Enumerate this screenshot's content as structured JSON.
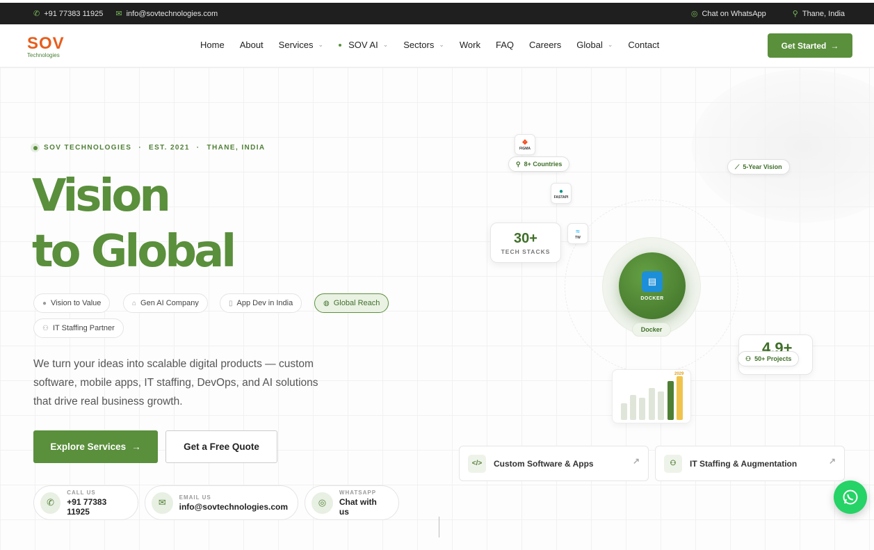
{
  "topbar": {
    "phone": "+91 77383 11925",
    "email": "info@sovtechnologies.com",
    "whatsapp": "Chat on WhatsApp",
    "location": "Thane, India"
  },
  "brand": {
    "logo_main": "SOV",
    "logo_sub": "Technologies",
    "accent": "#5a8f3c",
    "logo_color": "#e85d1c"
  },
  "nav": {
    "items": [
      {
        "label": "Home"
      },
      {
        "label": "About"
      },
      {
        "label": "Services"
      },
      {
        "label": "SOV AI"
      },
      {
        "label": "Sectors"
      },
      {
        "label": "Work"
      },
      {
        "label": "FAQ"
      },
      {
        "label": "Careers"
      },
      {
        "label": "Global"
      },
      {
        "label": "Contact"
      }
    ],
    "cta": "Get Started"
  },
  "hero": {
    "eyebrow": [
      "SOV TECHNOLOGIES",
      "EST. 2021",
      "THANE, INDIA"
    ],
    "title_line1": "Vision",
    "title_line2": "to Global",
    "chips": [
      {
        "label": "Vision to Value"
      },
      {
        "label": "Gen AI Company"
      },
      {
        "label": "App Dev in India"
      },
      {
        "label": "Global Reach"
      },
      {
        "label": "IT Staffing Partner"
      }
    ],
    "description": "We turn your ideas into scalable digital products — custom software, mobile apps, IT staffing, DevOps, and AI solutions that drive real business growth.",
    "primary_button": "Explore Services",
    "secondary_button": "Get a Free Quote",
    "contacts": [
      {
        "label": "CALL US",
        "value": "+91 77383 11925"
      },
      {
        "label": "EMAIL US",
        "value": "info@sovtechnologies.com"
      },
      {
        "label": "WHATSAPP",
        "value": "Chat with us"
      }
    ]
  },
  "visual": {
    "tiles": {
      "figma": "FIGMA",
      "fastapi": "FASTAPI",
      "tw": "TW"
    },
    "pills": {
      "countries": "8+ Countries",
      "vision": "5-Year Vision",
      "projects": "50+ Projects"
    },
    "stat": {
      "number": "30+",
      "label": "TECH STACKS"
    },
    "core": {
      "name": "DOCKER",
      "label": "Docker"
    },
    "rating": "4.9+",
    "chart": {
      "year_label": "2029"
    },
    "features": [
      {
        "label": "Custom Software & Apps"
      },
      {
        "label": "IT Staffing & Augmentation"
      }
    ]
  }
}
